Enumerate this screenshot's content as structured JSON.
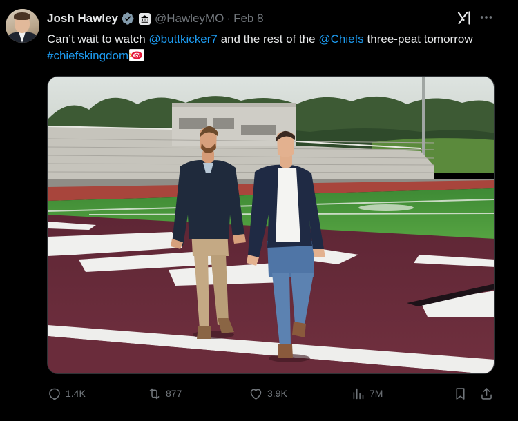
{
  "author": {
    "name": "Josh Hawley",
    "handle": "@HawleyMO",
    "separator": "·",
    "date": "Feb 8"
  },
  "tweet": {
    "text_1": "Can’t wait to watch ",
    "mention_1": "@buttkicker7",
    "text_2": " and the rest of the ",
    "mention_2": "@Chiefs",
    "text_3": " three-peat tomorrow ",
    "hashtag": "#chiefskingdom",
    "emoji": "kc-chiefs-flag-icon"
  },
  "metrics": {
    "replies": "1.4K",
    "reposts": "877",
    "likes": "3.9K",
    "views": "7M"
  },
  "colors": {
    "background": "#000000",
    "text": "#e7e9ea",
    "secondary": "#71767b",
    "link": "#1d9bf0",
    "verified_badge": "#829aab",
    "field_maroon": "#6e2a3a",
    "turf_green": "#4f9a3c"
  }
}
